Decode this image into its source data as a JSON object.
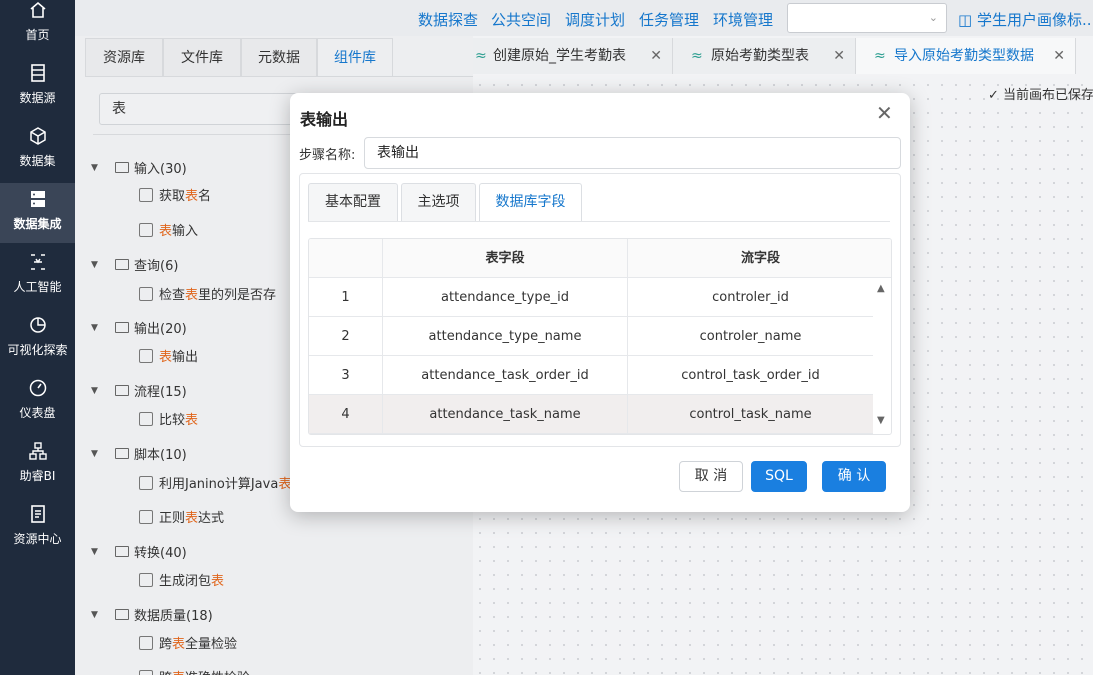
{
  "nav": {
    "items": [
      {
        "label": "首页",
        "icon": "home-icon"
      },
      {
        "label": "数据源",
        "icon": "database-icon"
      },
      {
        "label": "数据集",
        "icon": "cube-icon"
      },
      {
        "label": "数据集成",
        "icon": "server-icon",
        "active": true
      },
      {
        "label": "人工智能",
        "icon": "ai-icon"
      },
      {
        "label": "可视化探索",
        "icon": "pie-chart-icon"
      },
      {
        "label": "仪表盘",
        "icon": "gauge-icon"
      },
      {
        "label": "助睿BI",
        "icon": "hierarchy-icon"
      },
      {
        "label": "资源中心",
        "icon": "document-icon"
      }
    ]
  },
  "topbar": {
    "menus": [
      "数据探查",
      "公共空间",
      "调度计划",
      "任务管理",
      "环境管理"
    ],
    "select_value": "",
    "user_label": "学生用户画像标..."
  },
  "panel": {
    "tabs": [
      "资源库",
      "文件库",
      "元数据",
      "组件库"
    ],
    "active_tab": "组件库",
    "search_value": "表",
    "tree": [
      {
        "type": "group",
        "label": "输入(30)"
      },
      {
        "type": "leaf",
        "pre": "获取 ",
        "hl": "表",
        "post": " 名"
      },
      {
        "type": "leaf",
        "pre": "",
        "hl": "表",
        "post": " 输入"
      },
      {
        "type": "group",
        "label": "查询(6)"
      },
      {
        "type": "leaf",
        "pre": "检查 ",
        "hl": "表",
        "post": " 里的列是否存"
      },
      {
        "type": "group",
        "label": "输出(20)"
      },
      {
        "type": "leaf",
        "pre": "",
        "hl": "表",
        "post": " 输出"
      },
      {
        "type": "group",
        "label": "流程(15)"
      },
      {
        "type": "leaf",
        "pre": "比较 ",
        "hl": "表",
        "post": ""
      },
      {
        "type": "group",
        "label": "脚本(10)"
      },
      {
        "type": "leaf",
        "pre": "利用Janino计算Java ",
        "hl": "表",
        "post": ""
      },
      {
        "type": "leaf",
        "pre": "正则 ",
        "hl": "表",
        "post": " 达式"
      },
      {
        "type": "group",
        "label": "转换(40)"
      },
      {
        "type": "leaf",
        "pre": "生成闭包 ",
        "hl": "表",
        "post": ""
      },
      {
        "type": "group",
        "label": "数据质量(18)"
      },
      {
        "type": "leaf",
        "pre": "跨 ",
        "hl": "表",
        "post": " 全量检验"
      },
      {
        "type": "leaf",
        "pre": "跨 ",
        "hl": "表",
        "post": " 准确性检验"
      }
    ]
  },
  "editor": {
    "tabs": [
      "创建原始_学生考勤表",
      "原始考勤类型表",
      "导入原始考勤类型数据"
    ],
    "active_tab": "导入原始考勤类型数据",
    "saved_text": "当前画布已保存"
  },
  "dialog": {
    "title": "表输出",
    "step_label": "步骤名称:",
    "step_value": "表输出",
    "tabs": [
      "基本配置",
      "主选项",
      "数据库字段"
    ],
    "active_tab": "数据库字段",
    "columns": [
      "",
      "表字段",
      "流字段"
    ],
    "rows": [
      {
        "idx": "1",
        "table_field": "attendance_type_id",
        "stream_field": "controler_id"
      },
      {
        "idx": "2",
        "table_field": "attendance_type_name",
        "stream_field": "controler_name"
      },
      {
        "idx": "3",
        "table_field": "attendance_task_order_id",
        "stream_field": "control_task_order_id"
      },
      {
        "idx": "4",
        "table_field": "attendance_task_name",
        "stream_field": "control_task_name"
      }
    ],
    "buttons": {
      "cancel": "取 消",
      "sql": "SQL",
      "ok": "确 认"
    }
  }
}
